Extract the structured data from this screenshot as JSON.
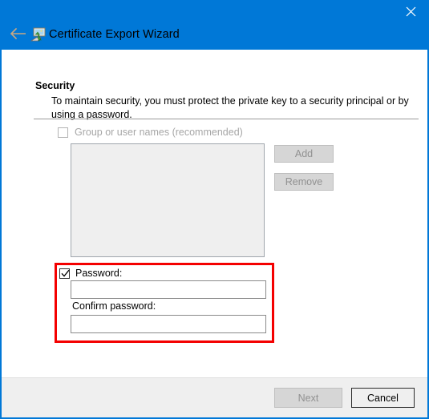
{
  "window": {
    "title": "Certificate Export Wizard",
    "accent_color": "#0078d7",
    "icons": {
      "close": "close-icon",
      "back": "back-arrow-icon",
      "title": "certificate-wizard-icon"
    }
  },
  "page": {
    "section_title": "Security",
    "section_description": "To maintain security, you must protect the private key to a security principal or by using a password."
  },
  "group_names": {
    "checkbox_label": "Group or user names (recommended)",
    "checked": false,
    "enabled": false,
    "list_items": []
  },
  "buttons": {
    "add": "Add",
    "remove": "Remove",
    "next": "Next",
    "cancel": "Cancel"
  },
  "password_section": {
    "checkbox_label": "Password:",
    "checked": true,
    "password_value": "",
    "password_placeholder": "",
    "confirm_label": "Confirm password:",
    "confirm_value": "",
    "confirm_placeholder": "",
    "highlight_color": "#f40000"
  }
}
